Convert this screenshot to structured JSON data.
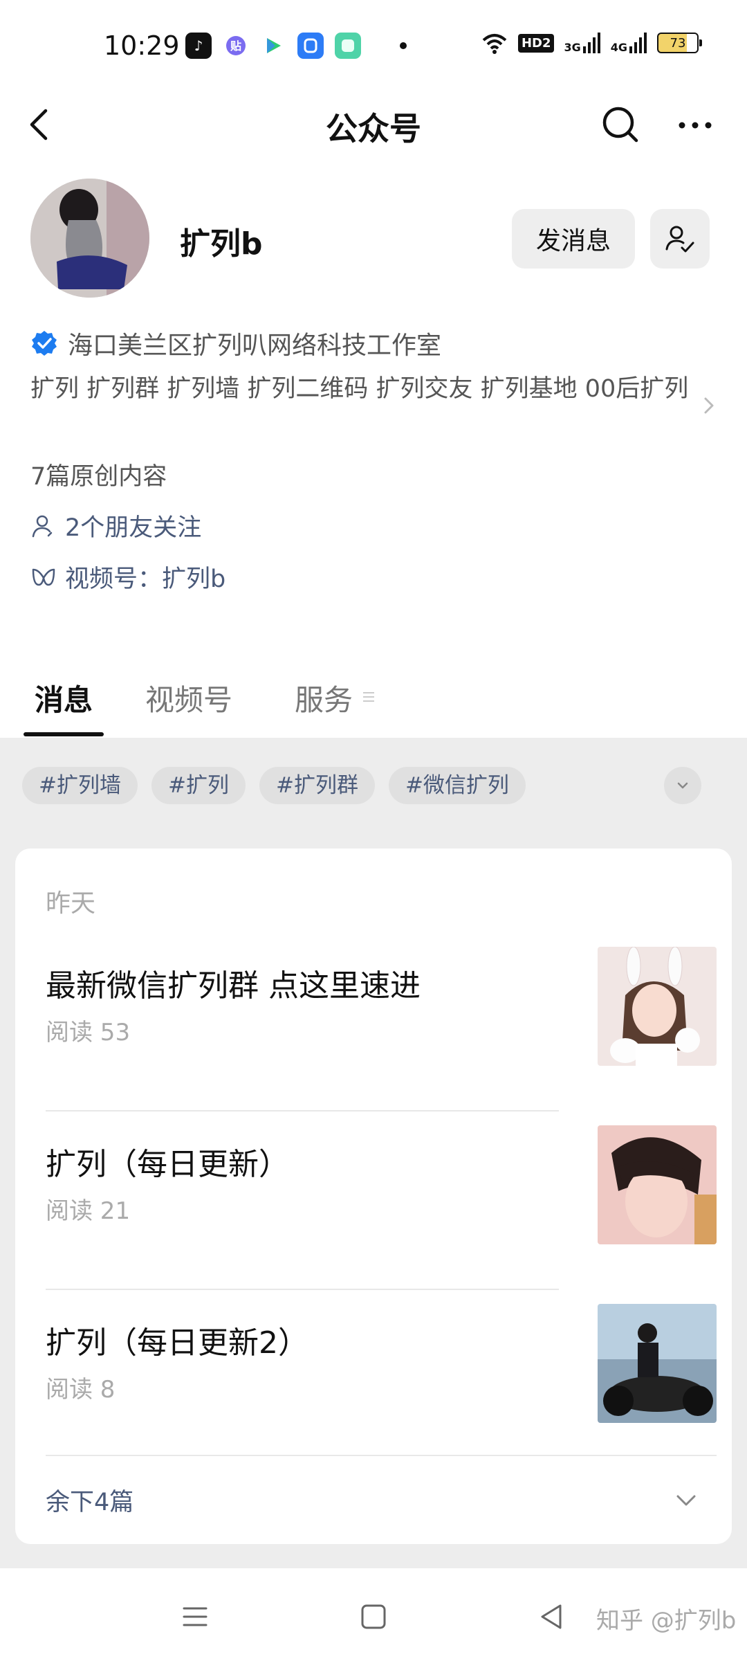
{
  "status_bar": {
    "time": "10:29",
    "network_hd": "HD2",
    "signal1": "3G",
    "signal2": "4G",
    "battery": "73",
    "app_icons": [
      "tiktok-icon",
      "tieba-icon",
      "video-play-icon",
      "shield-app-icon",
      "chat-app-icon"
    ]
  },
  "nav": {
    "title": "公众号"
  },
  "profile": {
    "name": "扩列b",
    "message_button": "发消息",
    "verified_entity": "海口美兰区扩列叭网络科技工作室",
    "description": "扩列 扩列群 扩列墙 扩列二维码 扩列交友 扩列基地 00后扩列",
    "original_count": "7篇原创内容",
    "friends_following": "2个朋友关注",
    "channel": "视频号：扩列b"
  },
  "tabs": [
    {
      "label": "消息",
      "active": true
    },
    {
      "label": "视频号",
      "active": false
    },
    {
      "label": "服务",
      "active": false
    }
  ],
  "hashtags": [
    "#扩列墙",
    "#扩列",
    "#扩列群",
    "#微信扩列"
  ],
  "feed": {
    "date_label": "昨天",
    "articles": [
      {
        "title": "最新微信扩列群 点这里速进",
        "reads": "阅读 53"
      },
      {
        "title": "扩列（每日更新）",
        "reads": "阅读 21"
      },
      {
        "title": "扩列（每日更新2）",
        "reads": "阅读 8"
      }
    ],
    "remaining": "余下4篇"
  },
  "watermark": "知乎 @扩列b",
  "colors": {
    "link": "#4a5a7a",
    "verified": "#1d7cf0",
    "content_bg": "#ededed"
  }
}
